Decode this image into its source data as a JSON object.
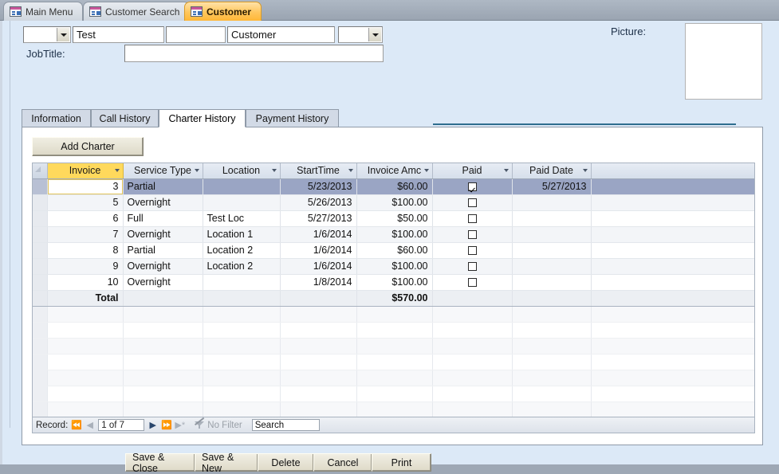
{
  "document_tabs": [
    {
      "label": "Main Menu",
      "icon": "access-form-icon",
      "active": false
    },
    {
      "label": "Customer Search",
      "icon": "access-form-icon",
      "active": false
    },
    {
      "label": "Customer",
      "icon": "access-form-icon",
      "active": true
    }
  ],
  "form_header": {
    "title_combo_value": "",
    "first_name_value": "Test",
    "middle_value": "",
    "last_name_value": "Customer",
    "suffix_combo_value": "",
    "jobtitle_label": "JobTitle:",
    "jobtitle_value": "",
    "picture_label": "Picture:"
  },
  "inner_tabs": [
    {
      "label": "Information",
      "active": false
    },
    {
      "label": "Call History",
      "active": false
    },
    {
      "label": "Charter History",
      "active": true
    },
    {
      "label": "Payment History",
      "active": false
    }
  ],
  "charter_tab": {
    "add_charter_label": "Add Charter",
    "columns": [
      {
        "label": "Invoice",
        "sorted": true
      },
      {
        "label": "Service Type",
        "sorted": false
      },
      {
        "label": "Location",
        "sorted": false
      },
      {
        "label": "StartTime",
        "sorted": false
      },
      {
        "label": "Invoice Amc",
        "sorted": false
      },
      {
        "label": "Paid",
        "sorted": false
      },
      {
        "label": "Paid Date",
        "sorted": false
      }
    ],
    "rows": [
      {
        "invoice": "3",
        "service_type": "Partial",
        "location": "",
        "start_time": "5/23/2013",
        "invoice_amount": "$60.00",
        "paid": true,
        "paid_date": "5/27/2013",
        "selected": true
      },
      {
        "invoice": "5",
        "service_type": "Overnight",
        "location": "",
        "start_time": "5/26/2013",
        "invoice_amount": "$100.00",
        "paid": false,
        "paid_date": "",
        "selected": false
      },
      {
        "invoice": "6",
        "service_type": "Full",
        "location": "Test Loc",
        "start_time": "5/27/2013",
        "invoice_amount": "$50.00",
        "paid": false,
        "paid_date": "",
        "selected": false
      },
      {
        "invoice": "7",
        "service_type": "Overnight",
        "location": "Location 1",
        "start_time": "1/6/2014",
        "invoice_amount": "$100.00",
        "paid": false,
        "paid_date": "",
        "selected": false
      },
      {
        "invoice": "8",
        "service_type": "Partial",
        "location": "Location 2",
        "start_time": "1/6/2014",
        "invoice_amount": "$60.00",
        "paid": false,
        "paid_date": "",
        "selected": false
      },
      {
        "invoice": "9",
        "service_type": "Overnight",
        "location": "Location 2",
        "start_time": "1/6/2014",
        "invoice_amount": "$100.00",
        "paid": false,
        "paid_date": "",
        "selected": false
      },
      {
        "invoice": "10",
        "service_type": "Overnight",
        "location": "",
        "start_time": "1/8/2014",
        "invoice_amount": "$100.00",
        "paid": false,
        "paid_date": "",
        "selected": false
      }
    ],
    "total_row": {
      "label": "Total",
      "invoice_amount": "$570.00"
    },
    "navigator": {
      "record_label": "Record:",
      "position": "1 of 7",
      "first_icon": "first-record-icon",
      "prev_icon": "previous-record-icon",
      "next_icon": "next-record-icon",
      "last_icon": "last-record-icon",
      "new_icon": "new-record-icon",
      "filter_label": "No Filter",
      "filter_icon": "filter-icon",
      "search_placeholder": "Search",
      "search_value": "Search"
    }
  },
  "footer_buttons": [
    {
      "label": "Save & Close"
    },
    {
      "label": "Save & New"
    },
    {
      "label": "Delete"
    },
    {
      "label": "Cancel"
    },
    {
      "label": "Print"
    }
  ],
  "colors": {
    "window_chrome": "#9ea8b5",
    "form_background": "#dce9f7",
    "active_tab_accent": "#ffb737",
    "sorted_header": "#ffd95c",
    "selected_row": "#9aa5c4",
    "teal_rule": "#2e6d8e"
  }
}
